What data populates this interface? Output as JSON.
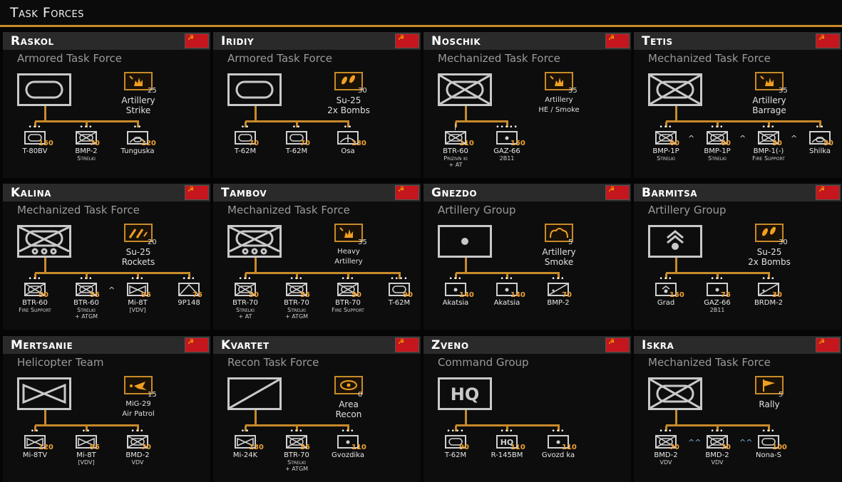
{
  "app": {
    "title": "Task Forces"
  },
  "colors": {
    "accent": "#c88a2a",
    "strength": "#f0a030",
    "flag": "#c4161c"
  },
  "cards": [
    {
      "name": "Raskol",
      "type": "Armored Task Force",
      "hq": "armor",
      "support": {
        "icon": "explosion-icon",
        "count": "25",
        "label1": "Artillery",
        "label2": "Strike"
      },
      "units": [
        {
          "dots": "•••",
          "sym": "armor",
          "str": "150",
          "name": "T-80BV",
          "sub": "",
          "chev": ""
        },
        {
          "dots": "•••",
          "sym": "mech",
          "str": "70",
          "name": "BMP-2",
          "sub": "Strelki",
          "chev": ""
        },
        {
          "dots": "••",
          "sym": "aa",
          "str": "120",
          "name": "Tunguska",
          "sub": "",
          "chev": ""
        }
      ]
    },
    {
      "name": "Iridiy",
      "type": "Armored Task Force",
      "hq": "armor",
      "support": {
        "icon": "bomb-icon",
        "count": "30",
        "label1": "Su-25",
        "label2": "2x Bombs"
      },
      "units": [
        {
          "dots": "••",
          "sym": "armor",
          "str": "70",
          "name": "T-62M",
          "sub": "",
          "chev": ""
        },
        {
          "dots": "••",
          "sym": "armor",
          "str": "70",
          "name": "T-62M",
          "sub": "",
          "chev": ""
        },
        {
          "dots": "••",
          "sym": "sam",
          "str": "130",
          "name": "Osa",
          "sub": "",
          "chev": ""
        }
      ]
    },
    {
      "name": "Noschik",
      "type": "Mechanized Task Force",
      "hq": "mech",
      "support": {
        "icon": "explosion-icon",
        "count": "35",
        "label1": "Artillery",
        "label2": "HE / Smoke"
      },
      "units": [
        {
          "dots": "|",
          "sym": "mech",
          "str": "110",
          "name": "BTR-60",
          "sub": "Prizivn ki",
          "sub2": "+ AT",
          "chev": ""
        },
        {
          "dots": "•••••",
          "sym": "arty",
          "str": "150",
          "name": "GAZ-66",
          "sub": "2B11",
          "chev": ""
        }
      ]
    },
    {
      "name": "Tetis",
      "type": "Mechanized Task Force",
      "hq": "mech",
      "support": {
        "icon": "explosion-icon",
        "count": "35",
        "label1": "Artillery",
        "label2": "Barrage"
      },
      "units": [
        {
          "dots": "•••",
          "sym": "mech",
          "str": "60",
          "name": "BMP-1P",
          "sub": "Strelki",
          "chev": "^"
        },
        {
          "dots": "•••",
          "sym": "mech",
          "str": "60",
          "name": "BMP-1P",
          "sub": "Strelki",
          "chev": "^"
        },
        {
          "dots": "•••",
          "sym": "mech",
          "str": "50",
          "name": "BMP-1(-)",
          "sub": "Fire Support",
          "chev": "^"
        },
        {
          "dots": "••",
          "sym": "aa",
          "str": "50",
          "name": "Shilka",
          "sub": "",
          "chev": ""
        }
      ]
    },
    {
      "name": "Kalina",
      "type": "Mechanized Task Force",
      "hq": "mech-wheeled",
      "support": {
        "icon": "rocket-icon",
        "count": "20",
        "label1": "Su-25",
        "label2": "Rockets"
      },
      "units": [
        {
          "dots": "•••",
          "sym": "mech",
          "str": "50",
          "name": "BTR-60",
          "sub": "Fire Support",
          "chev": ""
        },
        {
          "dots": "•••",
          "sym": "mech",
          "str": "55",
          "name": "BTR-60",
          "sub": "Strelki",
          "sub2": "+ ATGM",
          "chev": "^"
        },
        {
          "dots": "•••",
          "sym": "heli",
          "str": "95",
          "name": "Mi-8T",
          "sub": "[VDV]",
          "chev": ""
        },
        {
          "dots": "•••",
          "sym": "at",
          "str": "75",
          "name": "9P148",
          "sub": "",
          "chev": "^"
        }
      ]
    },
    {
      "name": "Tambov",
      "type": "Mechanized Task Force",
      "hq": "mech-wheeled",
      "support": {
        "icon": "explosion-icon",
        "count": "35",
        "label1": "Heavy",
        "label2": "Artillery"
      },
      "units": [
        {
          "dots": "•••",
          "sym": "mech",
          "str": "50",
          "name": "BTR-70",
          "sub": "Strelki",
          "sub2": "+ AT",
          "chev": ""
        },
        {
          "dots": "•••",
          "sym": "mech",
          "str": "55",
          "name": "BTR-70",
          "sub": "Strelki",
          "sub2": "+ ATGM",
          "chev": ""
        },
        {
          "dots": "•••",
          "sym": "mech",
          "str": "50",
          "name": "BTR-70",
          "sub": "Fire Support",
          "chev": ""
        },
        {
          "dots": "••••",
          "sym": "armor",
          "str": "90",
          "name": "T-62M",
          "sub": "",
          "chev": ""
        }
      ]
    },
    {
      "name": "Gnezdo",
      "type": "Artillery Group",
      "hq": "arty",
      "support": {
        "icon": "smoke-icon",
        "count": "5",
        "label1": "Artillery",
        "label2": "Smoke"
      },
      "units": [
        {
          "dots": "•••",
          "sym": "arty",
          "str": "140",
          "name": "Akatsia",
          "sub": "",
          "chev": ""
        },
        {
          "dots": "•••",
          "sym": "arty",
          "str": "140",
          "name": "Akatsia",
          "sub": "",
          "chev": ""
        },
        {
          "dots": "•••",
          "sym": "recon",
          "str": "70",
          "name": "BMP-2",
          "sub": "",
          "chev": ""
        }
      ]
    },
    {
      "name": "Barmitsa",
      "type": "Artillery Group",
      "hq": "mlrs",
      "support": {
        "icon": "bomb-icon",
        "count": "30",
        "label1": "Su-25",
        "label2": "2x Bombs"
      },
      "units": [
        {
          "dots": "•••",
          "sym": "mlrs",
          "str": "150",
          "name": "Grad",
          "sub": "",
          "chev": ""
        },
        {
          "dots": "•••",
          "sym": "arty",
          "str": "75",
          "name": "GAZ-66",
          "sub": "2B11",
          "chev": ""
        },
        {
          "dots": "•••",
          "sym": "recon",
          "str": "30",
          "name": "BRDM-2",
          "sub": "",
          "chev": ""
        }
      ]
    },
    {
      "name": "Mertsanie",
      "type": "Helicopter Team",
      "hq": "heli",
      "support": {
        "icon": "jet-icon",
        "count": "15",
        "label1": "MiG-29",
        "label2": "Air Patrol"
      },
      "units": [
        {
          "dots": "••",
          "sym": "heli",
          "str": "120",
          "name": "Mi-8TV",
          "sub": "",
          "chev": ""
        },
        {
          "dots": "••",
          "sym": "heli",
          "str": "95",
          "name": "Mi-8T",
          "sub": "[VDV]",
          "chev": ""
        },
        {
          "dots": "•••",
          "sym": "mech",
          "str": "70",
          "name": "BMD-2",
          "sub": "VDV",
          "chev": ""
        }
      ]
    },
    {
      "name": "Kvartet",
      "type": "Recon Task Force",
      "hq": "recon",
      "support": {
        "icon": "eye-icon",
        "count": "0",
        "label1": "Area",
        "label2": "Recon"
      },
      "units": [
        {
          "dots": "••",
          "sym": "heli",
          "str": "130",
          "name": "Mi-24K",
          "sub": "",
          "chev": ""
        },
        {
          "dots": "•••",
          "sym": "mech",
          "str": "55",
          "name": "BTR-70",
          "sub": "Strelki",
          "sub2": "+ ATGM",
          "chev": ""
        },
        {
          "dots": "•••",
          "sym": "arty",
          "str": "110",
          "name": "Gvozdika",
          "sub": "",
          "chev": ""
        }
      ]
    },
    {
      "name": "Zveno",
      "type": "Command Group",
      "hq": "hq",
      "support": null,
      "units": [
        {
          "dots": "••••",
          "sym": "armor",
          "str": "90",
          "name": "T-62M",
          "sub": "",
          "chev": ""
        },
        {
          "dots": "•••",
          "sym": "hq",
          "str": "110",
          "name": "R-145BM",
          "sub": "",
          "chev": ""
        },
        {
          "dots": "•••",
          "sym": "arty",
          "str": "110",
          "name": "Gvozd ka",
          "sub": "",
          "chev": ""
        }
      ]
    },
    {
      "name": "Iskra",
      "type": "Mechanized Task Force",
      "hq": "mech",
      "support": {
        "icon": "flag-icon",
        "count": "5",
        "label1": "Rally",
        "label2": ""
      },
      "units": [
        {
          "dots": "•••",
          "sym": "mech",
          "str": "70",
          "name": "BMD-2",
          "sub": "VDV",
          "chev": "^^",
          "chevBlue": true
        },
        {
          "dots": "•••",
          "sym": "mech",
          "str": "70",
          "name": "BMD-2",
          "sub": "VDV",
          "chev": "^^",
          "chevBlue": true
        },
        {
          "dots": "•••",
          "sym": "armor",
          "str": "100",
          "name": "Nona-S",
          "sub": "",
          "chev": ""
        }
      ]
    }
  ]
}
